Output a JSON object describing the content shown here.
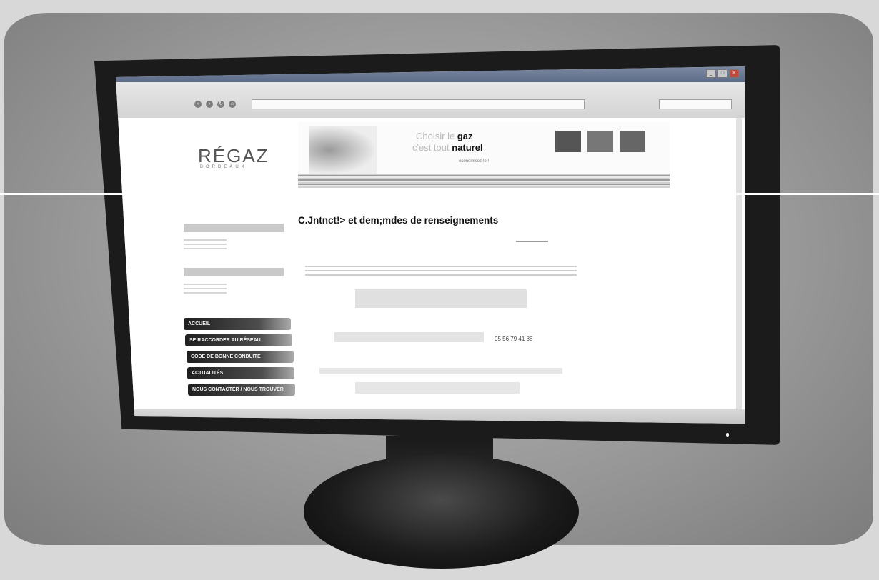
{
  "browser": {
    "window_title": "",
    "address": "",
    "window_buttons": [
      "_",
      "□",
      "×"
    ],
    "nav_icons": [
      "back-icon",
      "forward-icon",
      "reload-icon",
      "home-icon"
    ]
  },
  "site": {
    "logo": "RÉGAZ",
    "logo_subtitle": "BORDEAUX",
    "banner": {
      "line1_light": "Choisir le",
      "line1_bold": "gaz",
      "line2_light": "c'est tout",
      "line2_bold": "naturel",
      "line3": "économisez-le !"
    }
  },
  "menu": [
    {
      "label": "ACCUEIL"
    },
    {
      "label": "SE RACCORDER AU RÉSEAU"
    },
    {
      "label": "CODE DE BONNE CONDUITE"
    },
    {
      "label": "ACTUALITÉS"
    },
    {
      "label": "NOUS CONTACTER / NOUS TROUVER"
    }
  ],
  "main": {
    "title": "C.Jntnct!> et dem;mdes  de renseignements",
    "phone": "05 56 79 41 88"
  },
  "colors": {
    "page_bg": "#ffffff",
    "menu_dark": "#1f1f1f",
    "titlebar": "#5c6b88"
  }
}
